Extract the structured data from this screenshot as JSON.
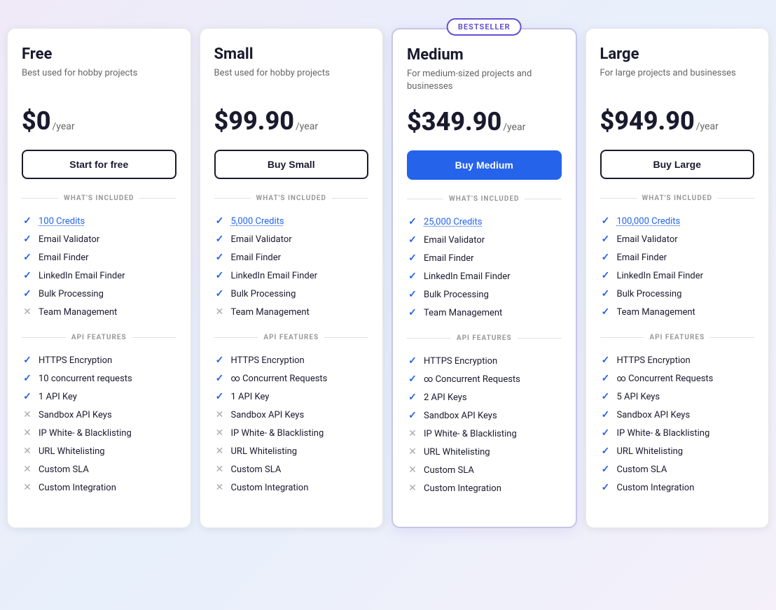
{
  "plans": [
    {
      "id": "free",
      "name": "Free",
      "desc": "Best used for hobby projects",
      "price": "$0",
      "period": "/year",
      "button": "Start for free",
      "featured": false,
      "bestseller": false,
      "whats_included": [
        {
          "text": "100 Credits",
          "checked": true,
          "link": true
        },
        {
          "text": "Email Validator",
          "checked": true,
          "link": false
        },
        {
          "text": "Email Finder",
          "checked": true,
          "link": false
        },
        {
          "text": "LinkedIn Email Finder",
          "checked": true,
          "link": false
        },
        {
          "text": "Bulk Processing",
          "checked": true,
          "link": false
        },
        {
          "text": "Team Management",
          "checked": false,
          "link": false
        }
      ],
      "api_features": [
        {
          "text": "HTTPS Encryption",
          "checked": true
        },
        {
          "text": "10 concurrent requests",
          "checked": true
        },
        {
          "text": "1 API Key",
          "checked": true
        },
        {
          "text": "Sandbox API Keys",
          "checked": false
        },
        {
          "text": "IP White- & Blacklisting",
          "checked": false
        },
        {
          "text": "URL Whitelisting",
          "checked": false
        },
        {
          "text": "Custom SLA",
          "checked": false
        },
        {
          "text": "Custom Integration",
          "checked": false
        }
      ]
    },
    {
      "id": "small",
      "name": "Small",
      "desc": "Best used for hobby projects",
      "price": "$99.90",
      "period": "/year",
      "button": "Buy Small",
      "featured": false,
      "bestseller": false,
      "whats_included": [
        {
          "text": "5,000 Credits",
          "checked": true,
          "link": true
        },
        {
          "text": "Email Validator",
          "checked": true,
          "link": false
        },
        {
          "text": "Email Finder",
          "checked": true,
          "link": false
        },
        {
          "text": "LinkedIn Email Finder",
          "checked": true,
          "link": false
        },
        {
          "text": "Bulk Processing",
          "checked": true,
          "link": false
        },
        {
          "text": "Team Management",
          "checked": false,
          "link": false
        }
      ],
      "api_features": [
        {
          "text": "HTTPS Encryption",
          "checked": true
        },
        {
          "text": "∞ Concurrent Requests",
          "checked": true
        },
        {
          "text": "1 API Key",
          "checked": true
        },
        {
          "text": "Sandbox API Keys",
          "checked": false
        },
        {
          "text": "IP White- & Blacklisting",
          "checked": false
        },
        {
          "text": "URL Whitelisting",
          "checked": false
        },
        {
          "text": "Custom SLA",
          "checked": false
        },
        {
          "text": "Custom Integration",
          "checked": false
        }
      ]
    },
    {
      "id": "medium",
      "name": "Medium",
      "desc": "For medium-sized projects and businesses",
      "price": "$349.90",
      "period": "/year",
      "button": "Buy Medium",
      "featured": true,
      "bestseller": true,
      "bestseller_label": "BESTSELLER",
      "whats_included": [
        {
          "text": "25,000 Credits",
          "checked": true,
          "link": true
        },
        {
          "text": "Email Validator",
          "checked": true,
          "link": false
        },
        {
          "text": "Email Finder",
          "checked": true,
          "link": false
        },
        {
          "text": "LinkedIn Email Finder",
          "checked": true,
          "link": false
        },
        {
          "text": "Bulk Processing",
          "checked": true,
          "link": false
        },
        {
          "text": "Team Management",
          "checked": true,
          "link": false
        }
      ],
      "api_features": [
        {
          "text": "HTTPS Encryption",
          "checked": true
        },
        {
          "text": "∞ Concurrent Requests",
          "checked": true
        },
        {
          "text": "2 API Keys",
          "checked": true
        },
        {
          "text": "Sandbox API Keys",
          "checked": true
        },
        {
          "text": "IP White- & Blacklisting",
          "checked": false
        },
        {
          "text": "URL Whitelisting",
          "checked": false
        },
        {
          "text": "Custom SLA",
          "checked": false
        },
        {
          "text": "Custom Integration",
          "checked": false
        }
      ]
    },
    {
      "id": "large",
      "name": "Large",
      "desc": "For large projects and businesses",
      "price": "$949.90",
      "period": "/year",
      "button": "Buy Large",
      "featured": false,
      "bestseller": false,
      "whats_included": [
        {
          "text": "100,000 Credits",
          "checked": true,
          "link": true
        },
        {
          "text": "Email Validator",
          "checked": true,
          "link": false
        },
        {
          "text": "Email Finder",
          "checked": true,
          "link": false
        },
        {
          "text": "LinkedIn Email Finder",
          "checked": true,
          "link": false
        },
        {
          "text": "Bulk Processing",
          "checked": true,
          "link": false
        },
        {
          "text": "Team Management",
          "checked": true,
          "link": false
        }
      ],
      "api_features": [
        {
          "text": "HTTPS Encryption",
          "checked": true
        },
        {
          "text": "∞ Concurrent Requests",
          "checked": true
        },
        {
          "text": "5 API Keys",
          "checked": true
        },
        {
          "text": "Sandbox API Keys",
          "checked": true
        },
        {
          "text": "IP White- & Blacklisting",
          "checked": true
        },
        {
          "text": "URL Whitelisting",
          "checked": true
        },
        {
          "text": "Custom SLA",
          "checked": true
        },
        {
          "text": "Custom Integration",
          "checked": true
        }
      ]
    }
  ],
  "sections": {
    "whats_included": "WHAT'S INCLUDED",
    "api_features": "API FEATURES"
  }
}
